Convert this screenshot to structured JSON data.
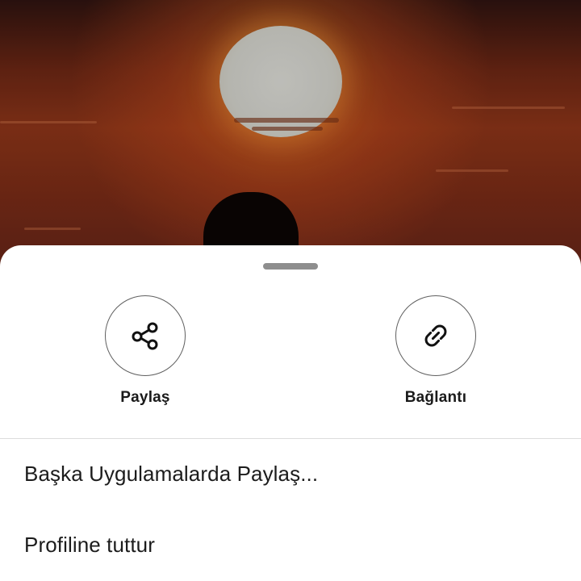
{
  "share_sheet": {
    "actions": [
      {
        "label": "Paylaş",
        "icon": "share-icon"
      },
      {
        "label": "Bağlantı",
        "icon": "link-icon"
      }
    ],
    "menu_items": [
      {
        "label": "Başka Uygulamalarda Paylaş..."
      },
      {
        "label": "Profiline tuttur"
      }
    ]
  },
  "colors": {
    "sheet_background": "#ffffff",
    "icon_stroke": "#111111",
    "circle_border": "#5f5f5f",
    "text": "#1c1c1c",
    "handle": "#8e8e8e"
  }
}
